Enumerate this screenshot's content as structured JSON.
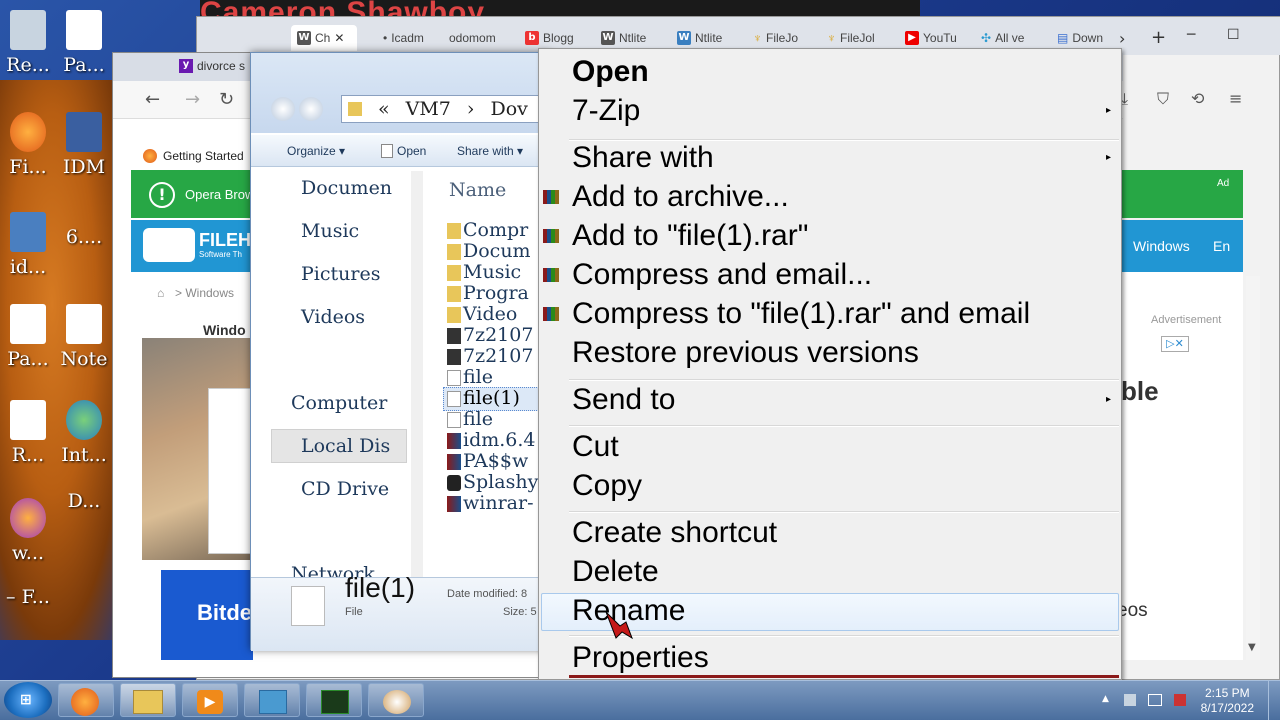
{
  "desktop": {
    "banner": "Cameron Shawboy",
    "icons": [
      {
        "label": "Re..."
      },
      {
        "label": "Pa..."
      },
      {
        "label": "Fi..."
      },
      {
        "label": "IDM"
      },
      {
        "label": "id..."
      },
      {
        "label": "6...."
      },
      {
        "label": "Pa..."
      },
      {
        "label": "Note"
      },
      {
        "label": "R..."
      },
      {
        "label": "Int..."
      },
      {
        "label": "w..."
      },
      {
        "label": "D..."
      },
      {
        "label": "– F..."
      }
    ]
  },
  "browser_tabs": [
    {
      "label": "Ch",
      "icon": "W"
    },
    {
      "label": "Icadm",
      "icon": "•"
    },
    {
      "label": "odomom",
      "icon": ""
    },
    {
      "label": "Blogg",
      "icon": "b"
    },
    {
      "label": "Ntlite",
      "icon": "W"
    },
    {
      "label": "Ntlite",
      "icon": "W"
    },
    {
      "label": "FileJo",
      "icon": "♆"
    },
    {
      "label": "FileJol",
      "icon": "♆"
    },
    {
      "label": "YouTu",
      "icon": "▶"
    },
    {
      "label": "All ve",
      "icon": "✣"
    },
    {
      "label": "Down",
      "icon": "▤"
    }
  ],
  "browser2": {
    "tab_title": "divorce s",
    "bookmark": "Getting Started",
    "opera_text": "Opera Brow",
    "ad_label": "Ad",
    "filehorse_text": "FILEH",
    "filehorse_sub": "Software Th",
    "nav_windows": "Windows",
    "nav_en": "En",
    "breadcrumb": "> Windows",
    "page_heading": "Windo",
    "advertisement": "Advertisement",
    "side_text": "ble",
    "bottom_text": "eos",
    "bitdefender": "Bitde"
  },
  "explorer": {
    "path": [
      "«",
      "VM7",
      "›",
      "Dov"
    ],
    "toolbar": {
      "organize": "Organize",
      "open": "Open",
      "share_with": "Share with"
    },
    "nav_items": [
      "Documen",
      "Music",
      "Pictures",
      "Videos",
      "Computer",
      "Local Dis",
      "CD Drive",
      "Network"
    ],
    "column_name": "Name",
    "files": [
      "Compr",
      "Docum",
      "Music",
      "Progra",
      "Video",
      "7z2107",
      "7z2107",
      "file",
      "file(1)",
      "file",
      "idm.6.4",
      "PA$$w",
      "Splashy",
      "winrar-"
    ],
    "status": {
      "name": "file(1)",
      "type": "File",
      "date_label": "Date modified: 8",
      "size_label": "Size: 5"
    }
  },
  "context_menu": {
    "items": [
      {
        "label": "Open",
        "bold": true
      },
      {
        "label": "7-Zip",
        "submenu": true
      },
      {
        "label": "Share with",
        "submenu": true
      },
      {
        "label": "Add to archive...",
        "icon": "rar"
      },
      {
        "label": "Add to \"file(1).rar\"",
        "icon": "rar"
      },
      {
        "label": "Compress and email...",
        "icon": "rar"
      },
      {
        "label": "Compress to \"file(1).rar\" and email",
        "icon": "rar"
      },
      {
        "label": "Restore previous versions"
      },
      {
        "label": "Send to",
        "submenu": true
      },
      {
        "label": "Cut"
      },
      {
        "label": "Copy"
      },
      {
        "label": "Create shortcut"
      },
      {
        "label": "Delete"
      },
      {
        "label": "Rename",
        "highlighted": true
      },
      {
        "label": "Properties"
      }
    ],
    "arrow": "▸"
  },
  "taskbar": {
    "time": "2:15 PM",
    "date": "8/17/2022",
    "tray_up": "▲"
  }
}
